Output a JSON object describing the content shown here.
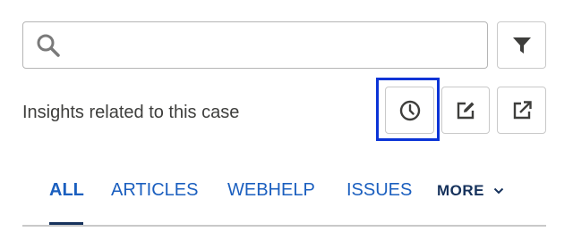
{
  "search": {
    "value": "",
    "placeholder": "",
    "icon": "search-icon"
  },
  "toolbar": {
    "filter_icon": "filter-icon",
    "history_icon": "clock-icon",
    "edit_icon": "edit-icon",
    "open_icon": "open-external-icon"
  },
  "insights": {
    "label": "Insights related to this case"
  },
  "tabs": [
    {
      "label": "ALL",
      "active": true
    },
    {
      "label": "ARTICLES",
      "active": false
    },
    {
      "label": "WEBHELP",
      "active": false
    },
    {
      "label": "ISSUES",
      "active": false
    }
  ],
  "more": {
    "label": "MORE",
    "icon": "chevron-down-icon"
  },
  "colors": {
    "accent": "#1b5fbf",
    "active_tab": "#16325c",
    "focus_ring": "#0b34d6",
    "border": "#c9c9c9"
  }
}
